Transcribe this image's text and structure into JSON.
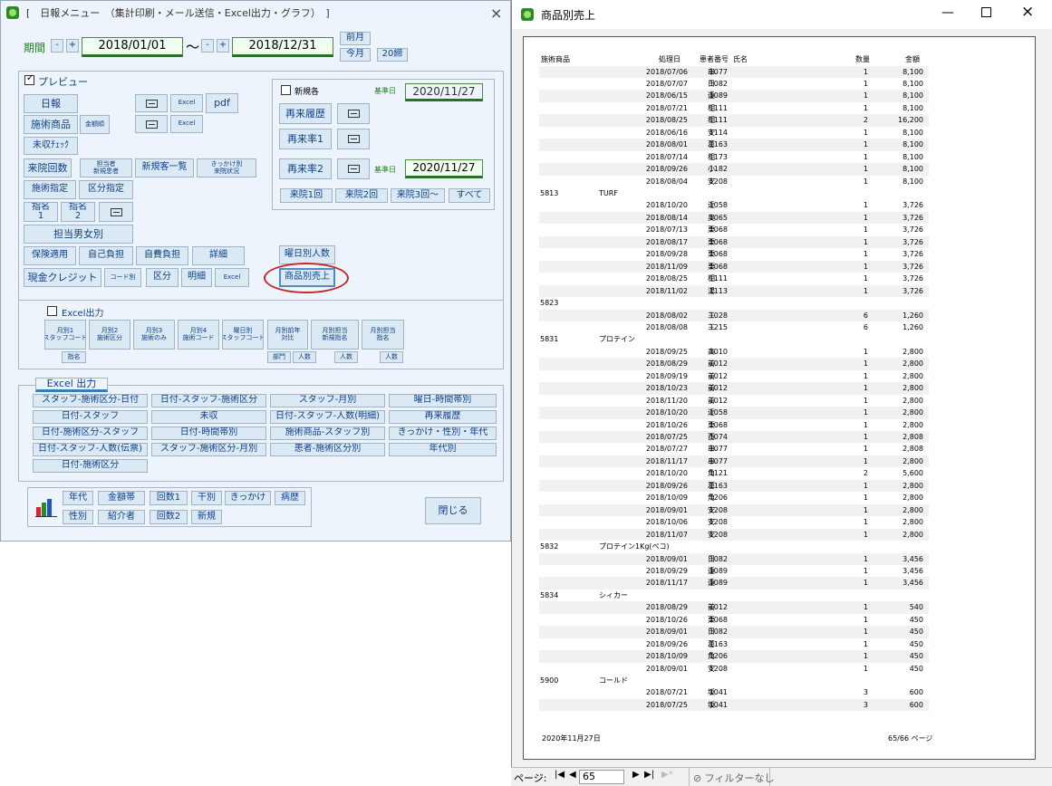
{
  "left_window": {
    "title": "[　日報メニュー　（集計印刷・メール送信・Excel出力・グラフ）　]",
    "close": "×",
    "period_label": "期間",
    "date_from": "2018/01/01",
    "date_to": "2018/12/31",
    "tilde": "～",
    "minus": "-",
    "plus": "+",
    "prev_month": "前月",
    "this_month": "今月",
    "close_20": "20締",
    "preview_label": "プレビュー",
    "buttons": {
      "nippo": "日報",
      "excel": "Excel",
      "pdf": "pdf",
      "sejutsu": "施術商品",
      "kingaku": "金額順",
      "mishu": "未収ﾁｪｯｸ",
      "raiin": "来院回数",
      "tanto": "担当者\n新規患者",
      "shinki": "新規客一覧",
      "kikkake": "きっかけ別\n来院状況",
      "sejutsu_shitei": "施術指定",
      "kubun_shitei": "区分指定",
      "shimei1": "指名\n1",
      "shimei2": "指名\n2",
      "danjo": "担当男女別",
      "hoken": "保険適用",
      "jiko": "自己負担",
      "jihi": "自費負担",
      "shosai": "詳細",
      "genkin": "現金クレジット",
      "code": "コード別",
      "kubun": "区分",
      "meisai": "明細",
      "youbi_ninzu": "曜日別人数",
      "shohin": "商品別売上"
    },
    "shinki_label": "新規各",
    "kijunbi": "基準日",
    "kijun_date": "2020/11/27",
    "kijun_date2": "2020/11/27",
    "sairai_rireki": "再来履歴",
    "sairai1": "再来率1",
    "sairai2": "再来率2",
    "visits": [
      "来院1回",
      "来院2回",
      "来院3回～",
      "すべて"
    ],
    "excel_out_label": "Excel出力",
    "excel_buttons": [
      "月別1\nスタッフコード",
      "月別2\n施術区分",
      "月別3\n施術のみ",
      "月別4\n施術コード",
      "曜日別\nスタッフコード",
      "月別前年\n対比",
      "月別担当\n新規指名",
      "月別担当\n指名"
    ],
    "sub_buttons": [
      "指名",
      "部門",
      "人数",
      "人数",
      "人数"
    ],
    "excel_section_title": "Excel 出力",
    "excel_grid": [
      [
        "スタッフ-施術区分-日付",
        "日付-スタッフ-施術区分",
        "スタッフ-月別",
        "曜日-時間帯別"
      ],
      [
        "日付-スタッフ",
        "未収",
        "日付-スタッフ-人数(明細)",
        "再来履歴"
      ],
      [
        "日付-施術区分-スタッフ",
        "日付-時間帯別",
        "施術商品-スタッフ別",
        "きっかけ・性別・年代"
      ],
      [
        "日付-スタッフ-人数(伝票)",
        "スタッフ-施術区分-月別",
        "患者-施術区分別",
        "年代別"
      ],
      [
        "日付-施術区分"
      ]
    ],
    "graph_buttons": [
      [
        "年代",
        "金額帯",
        "回数1",
        "干別",
        "きっかけ",
        "病歴"
      ],
      [
        "性別",
        "紹介者",
        "回数2",
        "新規"
      ]
    ],
    "close_btn": "閉じる"
  },
  "right_window": {
    "title": "商品別売上",
    "headers": {
      "item": "施術商品",
      "date": "処理日",
      "patient": "患者番号",
      "name": "氏名",
      "qty": "数量",
      "amount": "金額"
    },
    "rows": [
      {
        "d": "2018/07/06",
        "p": "1077",
        "n": "串",
        "q": "1",
        "a": "8,100"
      },
      {
        "d": "2018/07/07",
        "p": "1082",
        "n": "日",
        "q": "1",
        "a": "8,100"
      },
      {
        "d": "2018/06/15",
        "p": "1089",
        "n": "遠",
        "q": "1",
        "a": "8,100"
      },
      {
        "d": "2018/07/21",
        "p": "1111",
        "n": "相",
        "q": "1",
        "a": "8,100"
      },
      {
        "d": "2018/08/25",
        "p": "1111",
        "n": "相",
        "q": "2",
        "a": "16,200"
      },
      {
        "d": "2018/06/16",
        "p": "1114",
        "n": "安",
        "q": "1",
        "a": "8,100"
      },
      {
        "d": "2018/08/01",
        "p": "1163",
        "n": "葛",
        "q": "1",
        "a": "8,100"
      },
      {
        "d": "2018/07/14",
        "p": "1173",
        "n": "相",
        "q": "1",
        "a": "8,100"
      },
      {
        "d": "2018/09/26",
        "p": "1182",
        "n": "小",
        "q": "1",
        "a": "8,100"
      },
      {
        "d": "2018/08/04",
        "p": "1208",
        "n": "安",
        "q": "1",
        "a": "8,100"
      },
      {
        "code": "5813",
        "item": "TURF"
      },
      {
        "d": "2018/10/20",
        "p": "1058",
        "n": "近",
        "q": "1",
        "a": "3,726"
      },
      {
        "d": "2018/08/14",
        "p": "1065",
        "n": "奥",
        "q": "1",
        "a": "3,726"
      },
      {
        "d": "2018/07/13",
        "p": "1068",
        "n": "栗",
        "q": "1",
        "a": "3,726"
      },
      {
        "d": "2018/08/17",
        "p": "1068",
        "n": "栗",
        "q": "1",
        "a": "3,726"
      },
      {
        "d": "2018/09/28",
        "p": "1068",
        "n": "栗",
        "q": "1",
        "a": "3,726"
      },
      {
        "d": "2018/11/09",
        "p": "1068",
        "n": "栗",
        "q": "1",
        "a": "3,726"
      },
      {
        "d": "2018/08/25",
        "p": "1111",
        "n": "相",
        "q": "1",
        "a": "3,726"
      },
      {
        "d": "2018/11/02",
        "p": "1113",
        "n": "湯",
        "q": "1",
        "a": "3,726"
      },
      {
        "code": "5823",
        "item": ""
      },
      {
        "d": "2018/08/02",
        "p": "1028",
        "n": "三",
        "q": "6",
        "a": "1,260"
      },
      {
        "d": "2018/08/08",
        "p": "1215",
        "n": "三",
        "q": "6",
        "a": "1,260"
      },
      {
        "code": "5831",
        "item": "プロテイン"
      },
      {
        "d": "2018/09/25",
        "p": "1010",
        "n": "高",
        "q": "1",
        "a": "2,800"
      },
      {
        "d": "2018/08/29",
        "p": "1012",
        "n": "前",
        "q": "1",
        "a": "2,800"
      },
      {
        "d": "2018/09/19",
        "p": "1012",
        "n": "前",
        "q": "1",
        "a": "2,800"
      },
      {
        "d": "2018/10/23",
        "p": "1012",
        "n": "前",
        "q": "1",
        "a": "2,800"
      },
      {
        "d": "2018/11/20",
        "p": "1012",
        "n": "前",
        "q": "1",
        "a": "2,800"
      },
      {
        "d": "2018/10/20",
        "p": "1058",
        "n": "近",
        "q": "1",
        "a": "2,800"
      },
      {
        "d": "2018/10/26",
        "p": "1068",
        "n": "栗",
        "q": "1",
        "a": "2,800"
      },
      {
        "d": "2018/07/25",
        "p": "1074",
        "n": "西",
        "q": "1",
        "a": "2,808"
      },
      {
        "d": "2018/07/27",
        "p": "1077",
        "n": "串",
        "q": "1",
        "a": "2,808"
      },
      {
        "d": "2018/11/17",
        "p": "1077",
        "n": "串",
        "q": "1",
        "a": "2,800"
      },
      {
        "d": "2018/10/20",
        "p": "1121",
        "n": "角",
        "q": "2",
        "a": "5,600"
      },
      {
        "d": "2018/09/26",
        "p": "1163",
        "n": "葛",
        "q": "1",
        "a": "2,800"
      },
      {
        "d": "2018/10/09",
        "p": "1206",
        "n": "角",
        "q": "1",
        "a": "2,800"
      },
      {
        "d": "2018/09/01",
        "p": "1208",
        "n": "安",
        "q": "1",
        "a": "2,800"
      },
      {
        "d": "2018/10/06",
        "p": "1208",
        "n": "安",
        "q": "1",
        "a": "2,800"
      },
      {
        "d": "2018/11/07",
        "p": "1208",
        "n": "安",
        "q": "1",
        "a": "2,800"
      },
      {
        "code": "5832",
        "item": "プロテイン1Kg(ペコ)"
      },
      {
        "d": "2018/09/01",
        "p": "1082",
        "n": "日",
        "q": "1",
        "a": "3,456"
      },
      {
        "d": "2018/09/29",
        "p": "1089",
        "n": "遠",
        "q": "1",
        "a": "3,456"
      },
      {
        "d": "2018/11/17",
        "p": "1089",
        "n": "遠",
        "q": "1",
        "a": "3,456"
      },
      {
        "code": "5834",
        "item": "シィカー"
      },
      {
        "d": "2018/08/29",
        "p": "1012",
        "n": "前",
        "q": "1",
        "a": "540"
      },
      {
        "d": "2018/10/26",
        "p": "1068",
        "n": "栗",
        "q": "1",
        "a": "450"
      },
      {
        "d": "2018/09/01",
        "p": "1082",
        "n": "日",
        "q": "1",
        "a": "450"
      },
      {
        "d": "2018/09/26",
        "p": "1163",
        "n": "葛",
        "q": "1",
        "a": "450"
      },
      {
        "d": "2018/10/09",
        "p": "1206",
        "n": "角",
        "q": "1",
        "a": "450"
      },
      {
        "d": "2018/09/01",
        "p": "1208",
        "n": "安",
        "q": "1",
        "a": "450"
      },
      {
        "code": "5900",
        "item": "コールド"
      },
      {
        "d": "2018/07/21",
        "p": "1041",
        "n": "坂",
        "q": "3",
        "a": "600"
      },
      {
        "d": "2018/07/25",
        "p": "1041",
        "n": "坂",
        "q": "3",
        "a": "600"
      }
    ],
    "footer_date": "2020年11月27日",
    "footer_page": "65/66 ページ",
    "nav_label": "ページ:",
    "page_num": "65",
    "filter": "フィルターなし"
  }
}
